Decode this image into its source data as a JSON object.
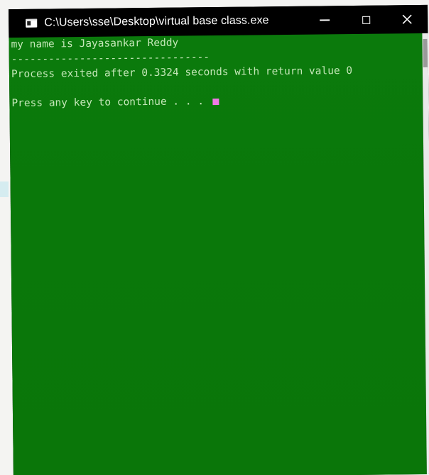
{
  "window": {
    "title": "C:\\Users\\sse\\Desktop\\virtual base class.exe",
    "icon": "console-app-icon",
    "controls": {
      "minimize_icon": "minimize-icon",
      "maximize_icon": "maximize-icon",
      "close_icon": "close-icon"
    }
  },
  "console": {
    "lines": [
      "my name is Jayasankar Reddy",
      "--------------------------------",
      "Process exited after 0.3324 seconds with return value 0",
      "",
      "Press any key to continue . . . "
    ],
    "colors": {
      "background": "#0a7a0a",
      "text": "#c4e7b8",
      "cursor": "#f07ae6"
    }
  }
}
